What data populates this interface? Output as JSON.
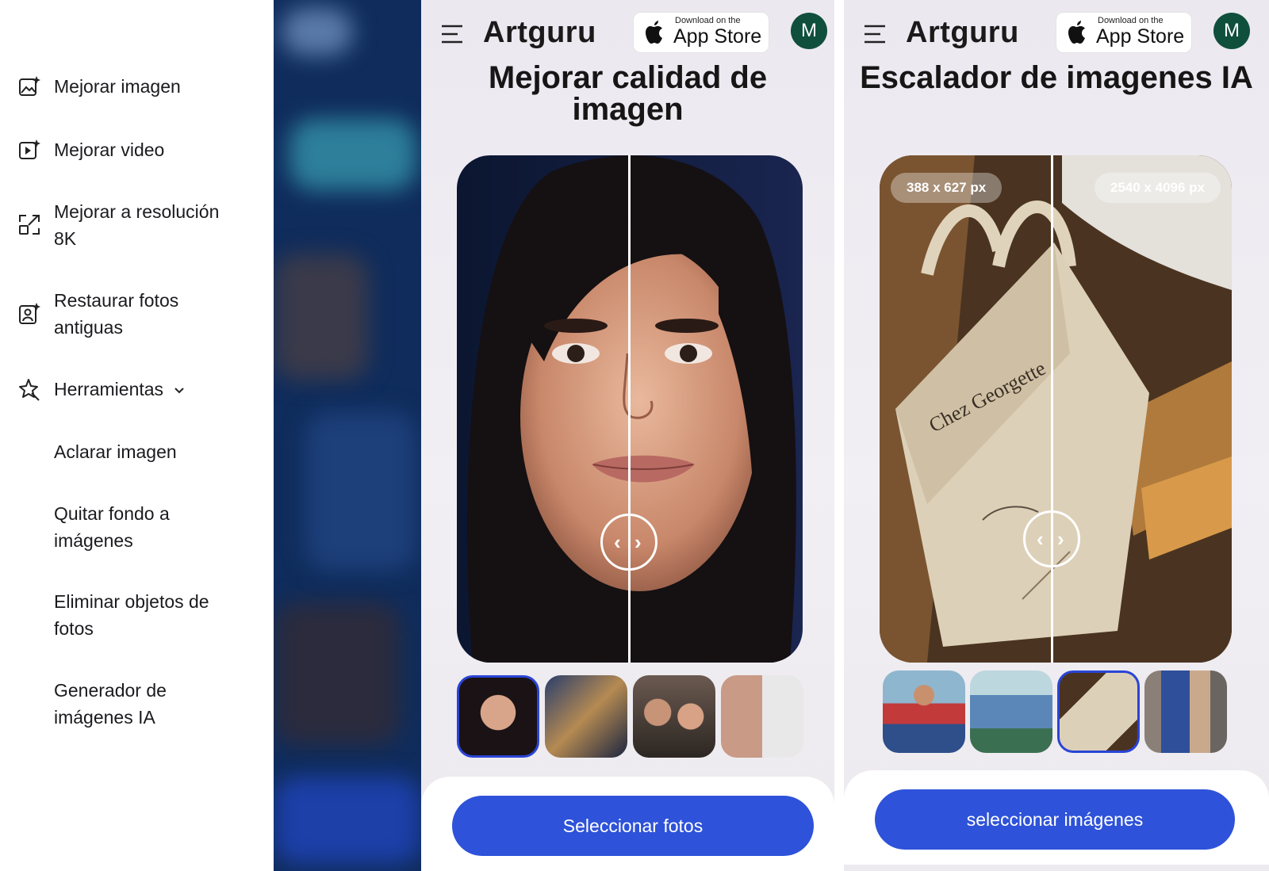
{
  "menu": {
    "items": [
      {
        "label": "Mejorar imagen",
        "icon": "image-sparkle-icon"
      },
      {
        "label": "Mejorar video",
        "icon": "video-sparkle-icon"
      },
      {
        "label": "Mejorar a resolución 8K",
        "icon": "expand-icon"
      },
      {
        "label": "Restaurar fotos antiguas",
        "icon": "portrait-sparkle-icon"
      },
      {
        "label": "Herramientas",
        "icon": "magic-star-icon"
      }
    ],
    "subitems": [
      {
        "label": "Aclarar imagen"
      },
      {
        "label": "Quitar fondo a imágenes"
      },
      {
        "label": "Eliminar objetos de fotos"
      },
      {
        "label": "Generador de imágenes IA"
      }
    ]
  },
  "brand": "Artguru",
  "appstore": {
    "small": "Download on the",
    "big": "App Store"
  },
  "avatar_letter": "M",
  "phone1": {
    "title": "Mejorar calidad de imagen",
    "cta": "Seleccionar fotos",
    "thumbs": [
      "portrait",
      "boat",
      "couple",
      "collage"
    ],
    "selected_thumb": 1
  },
  "phone2": {
    "title": "Escalador de imagenes IA",
    "badge_before": "388 x 627 px",
    "badge_after": "2540 x 4096 px",
    "bag_text": "Chez Georgette",
    "cta": "seleccionar imágenes",
    "thumbs": [
      "woman",
      "anime",
      "tote-bag",
      "two-people"
    ],
    "selected_thumb": 3
  },
  "colors": {
    "accent": "#2e52d9",
    "avatar": "#0f4f3c",
    "strip": "#0f2c5c"
  }
}
